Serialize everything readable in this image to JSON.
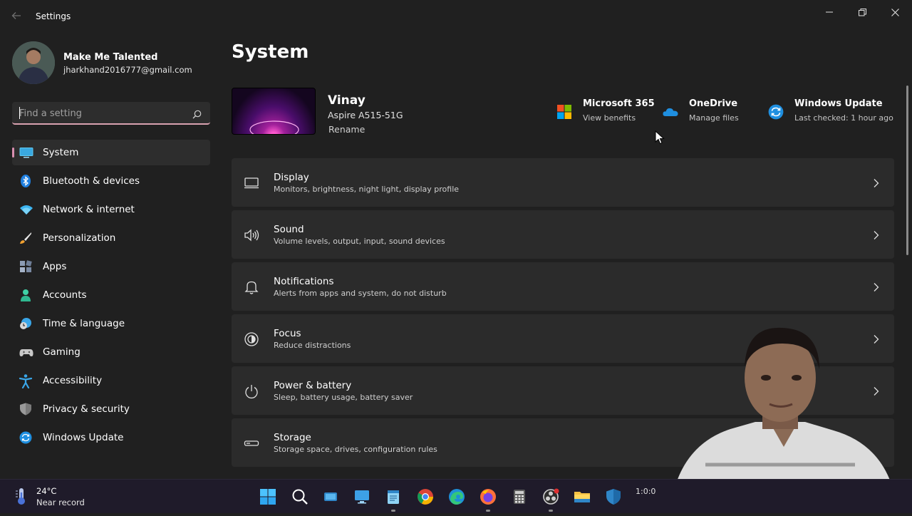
{
  "window": {
    "title": "Settings"
  },
  "profile": {
    "name": "Make Me Talented",
    "email": "jharkhand2016777@gmail.com"
  },
  "search": {
    "placeholder": "Find a setting"
  },
  "nav": {
    "items": [
      {
        "label": "System",
        "icon": "monitor-icon",
        "active": true
      },
      {
        "label": "Bluetooth & devices",
        "icon": "bluetooth-icon"
      },
      {
        "label": "Network & internet",
        "icon": "wifi-icon"
      },
      {
        "label": "Personalization",
        "icon": "brush-icon"
      },
      {
        "label": "Apps",
        "icon": "apps-icon"
      },
      {
        "label": "Accounts",
        "icon": "person-icon"
      },
      {
        "label": "Time & language",
        "icon": "globe-clock-icon"
      },
      {
        "label": "Gaming",
        "icon": "gamepad-icon"
      },
      {
        "label": "Accessibility",
        "icon": "accessibility-icon"
      },
      {
        "label": "Privacy & security",
        "icon": "shield-icon"
      },
      {
        "label": "Windows Update",
        "icon": "update-icon"
      }
    ]
  },
  "main": {
    "title": "System",
    "device": {
      "name": "Vinay",
      "model": "Aspire A515-51G",
      "rename_label": "Rename"
    },
    "quick_links": [
      {
        "title": "Microsoft 365",
        "subtitle": "View benefits",
        "icon": "microsoft-logo-icon"
      },
      {
        "title": "OneDrive",
        "subtitle": "Manage files",
        "icon": "cloud-icon"
      },
      {
        "title": "Windows Update",
        "subtitle": "Last checked: 1 hour ago",
        "icon": "update-icon"
      }
    ],
    "cards": [
      {
        "title": "Display",
        "subtitle": "Monitors, brightness, night light, display profile",
        "icon": "display-icon"
      },
      {
        "title": "Sound",
        "subtitle": "Volume levels, output, input, sound devices",
        "icon": "speaker-icon"
      },
      {
        "title": "Notifications",
        "subtitle": "Alerts from apps and system, do not disturb",
        "icon": "bell-icon"
      },
      {
        "title": "Focus",
        "subtitle": "Reduce distractions",
        "icon": "focus-icon"
      },
      {
        "title": "Power & battery",
        "subtitle": "Sleep, battery usage, battery saver",
        "icon": "power-icon"
      },
      {
        "title": "Storage",
        "subtitle": "Storage space, drives, configuration rules",
        "icon": "storage-icon"
      }
    ]
  },
  "taskbar": {
    "weather": {
      "temp": "24°C",
      "desc": "Near record"
    },
    "clock": "1:0:0"
  },
  "colors": {
    "accent": "#d98fb0",
    "background": "#202020",
    "card": "#2b2b2b",
    "taskbar": "#1f1b2a"
  }
}
